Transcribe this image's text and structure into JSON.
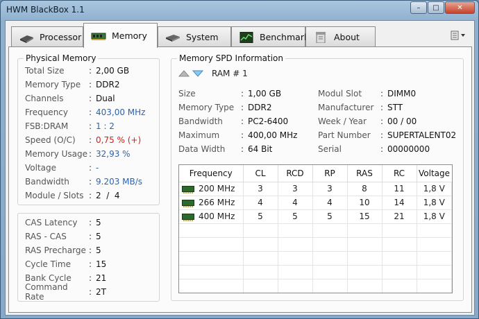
{
  "window": {
    "title": "HWM BlackBox 1.1"
  },
  "controls": {
    "minimize": "–",
    "maximize": "□",
    "close": "✕"
  },
  "tabs": [
    {
      "label": "Processor",
      "icon": "cpu-icon"
    },
    {
      "label": "Memory",
      "icon": "ram-icon"
    },
    {
      "label": "System",
      "icon": "system-icon"
    },
    {
      "label": "Benchmark",
      "icon": "benchmark-icon"
    },
    {
      "label": "About",
      "icon": "about-icon"
    }
  ],
  "physical": {
    "title": "Physical Memory",
    "rows": [
      {
        "label": "Total Size",
        "value": "2,00 GB"
      },
      {
        "label": "Memory Type",
        "value": "DDR2"
      },
      {
        "label": "Channels",
        "value": "Dual"
      },
      {
        "label": "Frequency",
        "value": "403,00 MHz"
      },
      {
        "label": "FSB:DRAM",
        "value": "1 : 2"
      },
      {
        "label": "Speed (O/C)",
        "value": "0,75 % (+)"
      },
      {
        "label": "Memory Usage",
        "value": "32,93 %"
      },
      {
        "label": "Voltage",
        "value": "-"
      },
      {
        "label": "Bandwidth",
        "value": "9.203 MB/s"
      },
      {
        "label": "Module / Slots",
        "value": "2  /  4"
      }
    ]
  },
  "timings": {
    "rows": [
      {
        "label": "CAS Latency",
        "value": "5"
      },
      {
        "label": "RAS - CAS",
        "value": "5"
      },
      {
        "label": "RAS Precharge",
        "value": "5"
      },
      {
        "label": "Cycle Time",
        "value": "15"
      },
      {
        "label": "Bank Cycle",
        "value": "21"
      },
      {
        "label": "Command Rate",
        "value": "2T"
      }
    ]
  },
  "spd": {
    "title": "Memory SPD Information",
    "ram_label": "RAM # 1",
    "left": [
      {
        "label": "Size",
        "value": "1,00 GB"
      },
      {
        "label": "Memory Type",
        "value": "DDR2"
      },
      {
        "label": "Bandwidth",
        "value": "PC2-6400"
      },
      {
        "label": "Maximum",
        "value": "400,00 MHz"
      },
      {
        "label": "Data Width",
        "value": "64 Bit"
      }
    ],
    "right": [
      {
        "label": "Modul Slot",
        "value": "DIMM0"
      },
      {
        "label": "Manufacturer",
        "value": "STT"
      },
      {
        "label": "Week / Year",
        "value": "00 / 00"
      },
      {
        "label": "Part Number",
        "value": "SUPERTALENT02"
      },
      {
        "label": "Serial",
        "value": "00000000"
      }
    ],
    "table": {
      "headers": [
        "Frequency",
        "CL",
        "RCD",
        "RP",
        "RAS",
        "RC",
        "Voltage"
      ],
      "rows": [
        [
          "200 MHz",
          "3",
          "3",
          "3",
          "8",
          "11",
          "1,8 V"
        ],
        [
          "266 MHz",
          "4",
          "4",
          "4",
          "10",
          "14",
          "1,8 V"
        ],
        [
          "400 MHz",
          "5",
          "5",
          "5",
          "15",
          "21",
          "1,8 V"
        ]
      ]
    }
  }
}
